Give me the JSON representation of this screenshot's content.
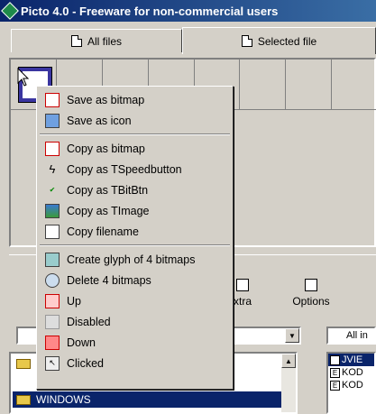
{
  "window": {
    "title": "Picto 4.0 - Freeware for non-commercial users"
  },
  "tabs": [
    {
      "label": "All files",
      "icon": "files-icon"
    },
    {
      "label": "Selected file",
      "icon": "file-icon"
    }
  ],
  "toolbar": {
    "extra_label": "xtra",
    "options_label": "Options"
  },
  "combo": {
    "left_value": "",
    "right_value": "All in"
  },
  "tree": {
    "items": [
      {
        "label": "",
        "icon": "folder-icon"
      },
      {
        "label": "WINDOWS",
        "icon": "folder-icon",
        "selected": true
      }
    ]
  },
  "filelist": {
    "items": [
      "JVIE",
      "KOD",
      "KOD"
    ]
  },
  "context_menu": {
    "items": [
      {
        "label": "Save as bitmap",
        "icon": "bitmap-icon"
      },
      {
        "label": "Save as icon",
        "icon": "icon-icon"
      },
      {
        "label": "Copy as bitmap",
        "icon": "bitmap-icon"
      },
      {
        "label": "Copy as TSpeedbutton",
        "icon": "lightning-icon"
      },
      {
        "label": "Copy as TBitBtn",
        "icon": "ok-check-icon"
      },
      {
        "label": "Copy as TImage",
        "icon": "image-icon"
      },
      {
        "label": "Copy filename",
        "icon": "document-icon"
      },
      {
        "label": "Create glyph of 4 bitmaps",
        "icon": "glyph-icon"
      },
      {
        "label": "Delete 4 bitmaps",
        "icon": "recycle-bin-icon"
      },
      {
        "label": "Up",
        "icon": "state-up-icon"
      },
      {
        "label": "Disabled",
        "icon": "state-disabled-icon"
      },
      {
        "label": "Down",
        "icon": "state-down-icon"
      },
      {
        "label": "Clicked",
        "icon": "state-clicked-icon"
      }
    ]
  },
  "colors": {
    "titlebar": "#0a246a",
    "selection": "#0a246a",
    "face": "#d4d0c8"
  }
}
